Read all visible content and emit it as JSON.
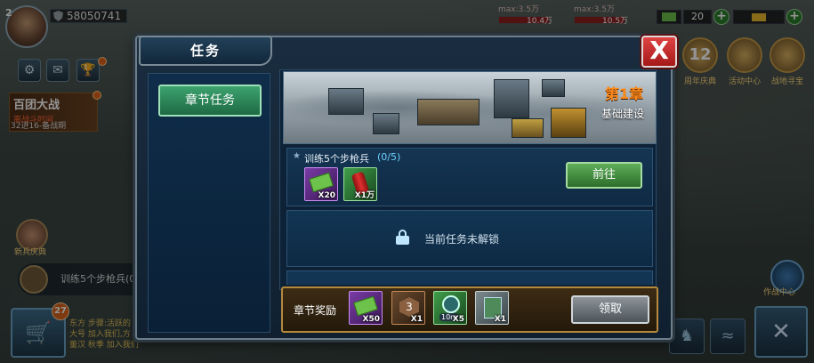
{
  "hud": {
    "level": "2",
    "power": "58050741",
    "res_left": {
      "max": "max:3.5万",
      "current": "10.4万"
    },
    "res_right": {
      "max": "max:3.5万",
      "current": "10.5万"
    },
    "chip_mid": "20",
    "plus": "+"
  },
  "left_ui": {
    "event_title": "百团大战",
    "event_subtitle": "离战斗时间",
    "event_note": "32进16-备战期",
    "newbie_label": "新兵庆典",
    "mission_bar_text": "训练5个步枪兵(0/5)",
    "shop_count": "27",
    "chat_lines": [
      "东方 步骤:活跃的",
      "大号 加入我们,方",
      "董汉 秋季 加入我们"
    ]
  },
  "right_ui": {
    "icons": [
      {
        "label": "周年庆典"
      },
      {
        "label": "活动中心"
      },
      {
        "label": "战地寻宝"
      }
    ],
    "anniversary_number": "12",
    "op_label": "作战中心"
  },
  "panel": {
    "title": "任务",
    "close": "X",
    "tab_label": "章节任务",
    "chapter_no": "第1章",
    "chapter_name": "基础建设",
    "task": {
      "title": "训练5个步枪兵",
      "progress": "(0/5)",
      "rewards": [
        {
          "icon": "cash-icon",
          "qty": "X20"
        },
        {
          "icon": "fuel-can-icon",
          "qty": "X1万"
        }
      ],
      "go_label": "前往"
    },
    "locked_text": "当前任务未解锁",
    "chapter_reward": {
      "label": "章节奖励",
      "items": [
        {
          "icon": "cash-stack-icon",
          "qty": "X50"
        },
        {
          "icon": "medal-3-icon",
          "qty": "X1"
        },
        {
          "icon": "speedup-10m-icon",
          "qty": "X5",
          "text": "10m"
        },
        {
          "icon": "card-icon",
          "qty": "X1"
        }
      ],
      "claim_label": "领取"
    }
  }
}
